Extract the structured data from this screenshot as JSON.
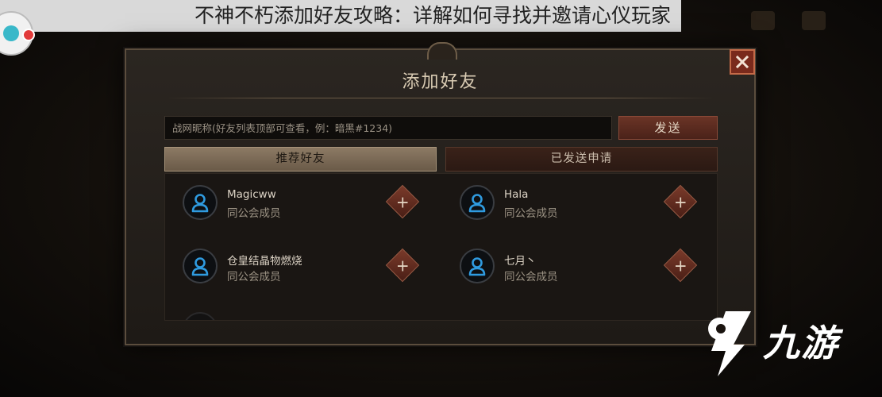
{
  "caption": {
    "title": "不神不朽添加好友攻略：详解如何寻找并邀请心仪玩家"
  },
  "dialog": {
    "title": "添加好友",
    "close_icon": "close-icon",
    "search": {
      "placeholder": "战网昵称(好友列表顶部可查看，例：暗黑#1234)",
      "value": ""
    },
    "send_label": "发送",
    "tabs": [
      {
        "label": "推荐好友",
        "active": true
      },
      {
        "label": "已发送申请",
        "active": false
      }
    ],
    "friends": [
      {
        "name": "Magicww",
        "subtitle": "同公会成员",
        "avatar_icon": "user-icon",
        "action_icon": "plus-icon"
      },
      {
        "name": "Hala",
        "subtitle": "同公会成员",
        "avatar_icon": "user-icon",
        "action_icon": "plus-icon"
      },
      {
        "name": "仓皇结晶物燃烧",
        "subtitle": "同公会成员",
        "avatar_icon": "user-icon",
        "action_icon": "plus-icon"
      },
      {
        "name": "七月丶",
        "subtitle": "同公会成员",
        "avatar_icon": "user-icon",
        "action_icon": "plus-icon"
      }
    ],
    "colors": {
      "accent_red": "#7a2a1c",
      "tab_active": "#8c7a64",
      "avatar_blue": "#2f9be0"
    }
  },
  "watermark": {
    "text": "九游",
    "logo_icon": "jiuyou-logo-icon"
  }
}
